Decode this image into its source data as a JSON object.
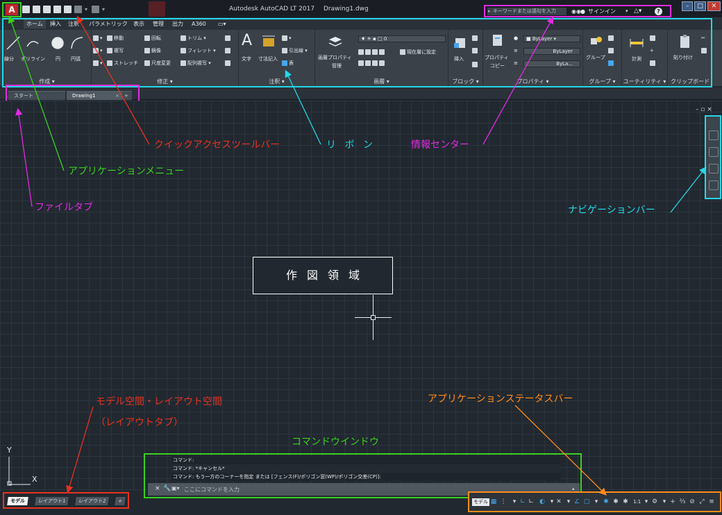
{
  "window": {
    "title": "Autodesk AutoCAD LT 2017",
    "document": "Drawing1.dwg"
  },
  "app_menu": {
    "logo": "A"
  },
  "infocenter": {
    "search_placeholder": "キーワードまたは語句を入力",
    "signin": "サインイン"
  },
  "ribbon_tabs": [
    "ホーム",
    "挿入",
    "注釈",
    "パラメトリック",
    "表示",
    "管理",
    "出力",
    "A360"
  ],
  "ribbon": {
    "draw": {
      "title": "作成 ▾",
      "line": "線分",
      "polyline": "ポリライン",
      "circle": "円",
      "arc": "円弧"
    },
    "modify": {
      "title": "修正 ▾",
      "move": "移動",
      "rotate": "回転",
      "trim": "トリム ▾",
      "copy": "複写",
      "mirror": "鏡像",
      "fillet": "フィレット ▾",
      "stretch": "ストレッチ",
      "scale": "尺度変更",
      "array": "配列複写 ▾"
    },
    "annotation": {
      "title": "注釈 ▾",
      "text": "文字",
      "dimension": "寸法記入",
      "leader": "引出線 ▾",
      "table": "表"
    },
    "layers": {
      "title": "画層 ▾",
      "layer_properties": "画層プロパティ",
      "manage": "管理",
      "layer_combo": "0",
      "make_current": "現在層に設定"
    },
    "block": {
      "title": "ブロック ▾",
      "insert": "挿入"
    },
    "properties": {
      "title": "プロパティ ▾",
      "match": "プロパティ",
      "copy": "コピー",
      "color": "ByLayer",
      "linetype": "ByLayer",
      "lineweight": "ByLa..."
    },
    "groups": {
      "title": "グループ ▾",
      "group": "グループ"
    },
    "utilities": {
      "title": "ユーティリティ ▾",
      "measure": "計測"
    },
    "clipboard": {
      "title": "クリップボード",
      "paste": "貼り付け"
    }
  },
  "file_tabs": [
    {
      "label": "スタート"
    },
    {
      "label": "Drawing1"
    }
  ],
  "drawing": {
    "label": "作図領域",
    "ucs_y": "Y",
    "ucs_x": "X"
  },
  "annotations": {
    "qat": "クイックアクセスツールバー",
    "ribbon": "リ ボ ン",
    "infocenter": "情報センター",
    "app_menu": "アプリケーションメニュー",
    "file_tab": "ファイルタブ",
    "navbar": "ナビゲーションバー",
    "model_space": "モデル空間・レイアウト空間",
    "layout_tab": "（レイアウトタブ）",
    "statusbar": "アプリケーションステータスバー",
    "command": "コマンドウインドウ"
  },
  "command": {
    "history": [
      "コマンド:",
      "コマンド: *キャンセル*",
      "コマンド: もう一方のコーナーを指定 または [フェンス(F)/ポリゴン窓(WP)/ポリゴン交差(CP)]:"
    ],
    "placeholder": "ここにコマンドを入力"
  },
  "layout_tabs": [
    "モデル",
    "レイアウト1",
    "レイアウト2",
    "+"
  ],
  "statusbar": {
    "model": "モデル",
    "scale": "1:1"
  },
  "colors": {
    "annotation_red": "#e8321f",
    "annotation_green": "#39d11f",
    "annotation_cyan": "#24d8e8",
    "annotation_magenta": "#e22be2",
    "annotation_orange": "#ff8c1a"
  }
}
